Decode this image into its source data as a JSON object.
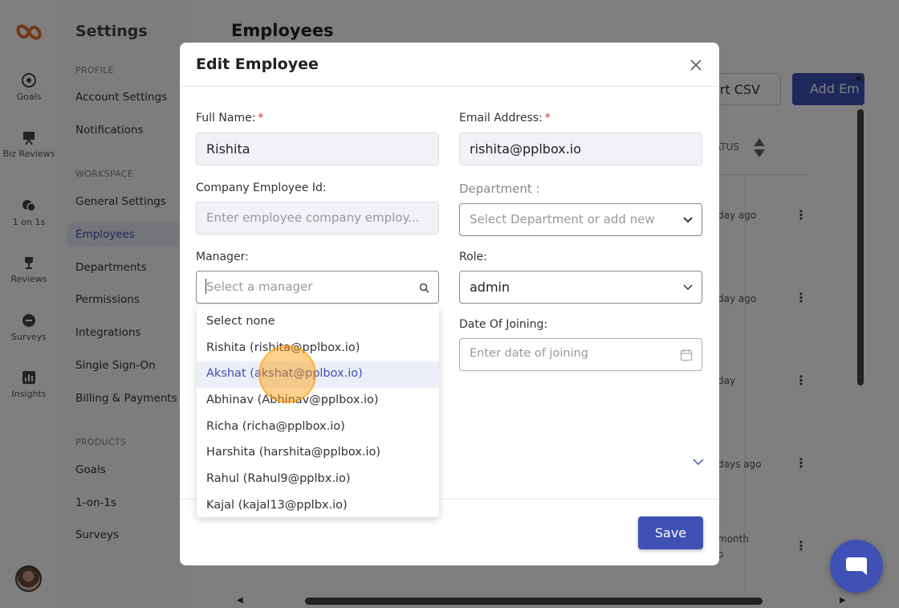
{
  "rail": {
    "items": [
      {
        "label": "Goals",
        "icon": "target-icon"
      },
      {
        "label": "Biz Reviews",
        "icon": "presentation-icon"
      },
      {
        "label": "1 on 1s",
        "icon": "chat-icon"
      },
      {
        "label": "Reviews",
        "icon": "trophy-icon"
      },
      {
        "label": "Surveys",
        "icon": "survey-icon"
      },
      {
        "label": "Insights",
        "icon": "bar-chart-icon"
      }
    ]
  },
  "settings_nav": {
    "title": "Settings",
    "profile_section": "PROFILE",
    "profile_items": [
      "Account Settings",
      "Notifications"
    ],
    "workspace_section": "WORKSPACE",
    "workspace_items": [
      "General Settings",
      "Employees",
      "Departments",
      "Permissions",
      "Integrations",
      "Single Sign-On",
      "Billing & Payments"
    ],
    "products_section": "PRODUCTS",
    "products_items": [
      "Goals",
      "1-on-1s",
      "Surveys"
    ]
  },
  "main": {
    "title": "Employees",
    "export_csv_partial": "ort CSV",
    "add_employee_partial": "Add Em",
    "status_header_partial": "ATUS",
    "row_texts": [
      "day ago",
      "day ago",
      "day",
      "days ago",
      "month",
      "o"
    ]
  },
  "modal": {
    "title": "Edit Employee",
    "full_name_label": "Full Name:",
    "full_name_value": "Rishita",
    "email_label": "Email Address:",
    "email_value": "rishita@pplbox.io",
    "required_mark": "*",
    "employee_id_label": "Company Employee Id:",
    "employee_id_placeholder": "Enter employee company employ...",
    "department_label": "Department :",
    "department_placeholder": "Select Department or add new",
    "manager_label": "Manager:",
    "manager_placeholder": "Select a manager",
    "role_label": "Role:",
    "role_value": "admin",
    "doj_label": "Date Of Joining:",
    "doj_placeholder": "Enter date of joining",
    "save_label": "Save"
  },
  "manager_dropdown": {
    "options": [
      "Select none",
      "Rishita (rishita@pplbox.io)",
      "Akshat (akshat@pplbox.io)",
      "Abhinav (Abhinav@pplbox.io)",
      "Richa (richa@pplbox.io)",
      "Harshita (harshita@pplbox.io)",
      "Rahul (Rahul9@pplbx.io)",
      "Kajal (kajal13@pplbx.io)"
    ],
    "highlighted_index": 2
  },
  "colors": {
    "primary": "#3f51b5",
    "required": "#d32f2f",
    "click_marker": "#ff9800",
    "logo": "#e8702a"
  }
}
